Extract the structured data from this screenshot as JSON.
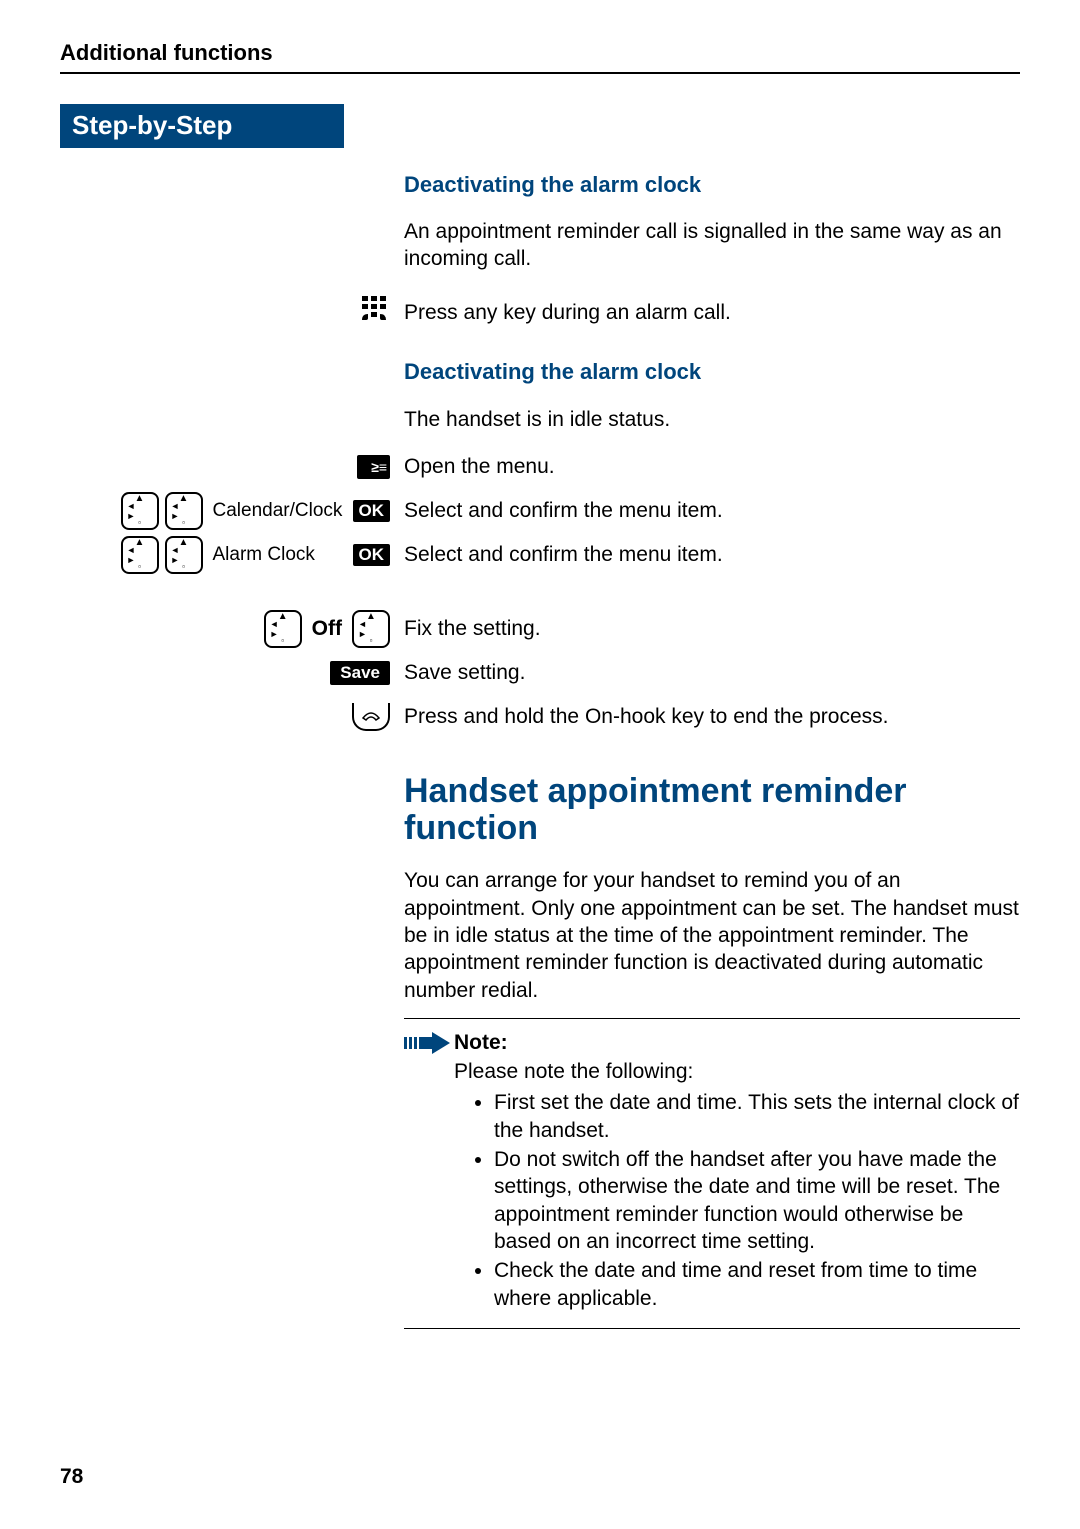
{
  "running_head": "Additional functions",
  "step_banner": "Step-by-Step",
  "sub1": "Deactivating the alarm clock",
  "p1": "An appointment reminder call is signalled in the same way as an incoming call.",
  "p2": "Press any key during an alarm call.",
  "sub2": "Deactivating the alarm clock",
  "p3": "The handset is in idle status.",
  "p4": "Open the menu.",
  "menu1": "Calendar/Clock",
  "p5": "Select and confirm the menu item.",
  "menu2": "Alarm Clock",
  "p6": "Select and confirm the menu item.",
  "off_label": "Off",
  "p7": "Fix the setting.",
  "save_label": "Save",
  "p8": "Save setting.",
  "p9": "Press and hold the On-hook key to end the process.",
  "ok_label": "OK",
  "h2": "Handset appointment reminder function",
  "p10": "You can arrange for your handset to remind you of an appointment. Only one appointment can be set. The handset must be in idle status at the time of the appointment reminder. The appointment reminder function is deactivated during automatic number redial.",
  "note_title": "Note:",
  "note_intro": "Please note the following:",
  "note_li1": "First set the date and time. This sets the internal clock of the handset.",
  "note_li2": "Do not switch off the handset after you have made the settings, otherwise the date and time will be reset. The appointment reminder function would otherwise be based on an incorrect time setting.",
  "note_li3": "Check the date and time and reset from time to time where applicable.",
  "page_num": "78"
}
